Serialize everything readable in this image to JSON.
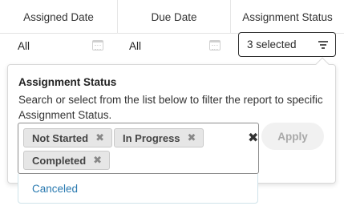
{
  "header": {
    "columns": [
      "Assigned Date",
      "Due Date",
      "Assignment Status"
    ]
  },
  "filters": {
    "assigned_date": {
      "value": "All",
      "icon": "calendar-icon"
    },
    "due_date": {
      "value": "All",
      "icon": "calendar-icon"
    },
    "assignment_status": {
      "value": "3 selected",
      "icon": "filter-icon"
    }
  },
  "popover": {
    "title": "Assignment Status",
    "description": "Search or select from the list below to filter the report to specific Assignment Status.",
    "chips": [
      {
        "label": "Not Started",
        "remove": "✖"
      },
      {
        "label": "In Progress",
        "remove": "✖"
      },
      {
        "label": "Completed",
        "remove": "✖"
      }
    ],
    "clear_all": "✖",
    "apply_label": "Apply",
    "dropdown_options": [
      "Canceled"
    ]
  }
}
